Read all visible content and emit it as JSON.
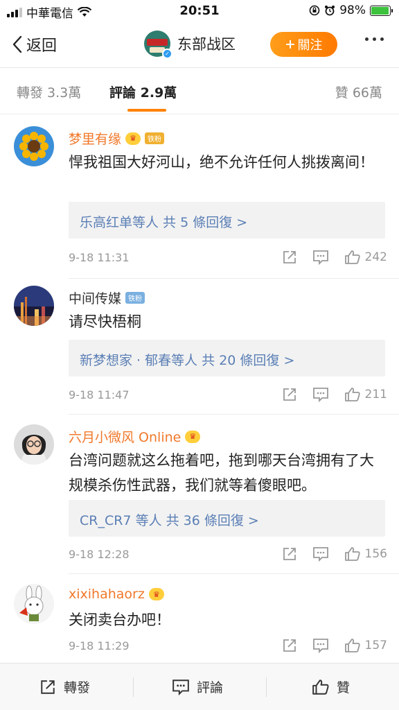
{
  "status_bar": {
    "carrier": "中華電信",
    "time": "20:51",
    "battery_percent": "98%",
    "battery_level": 0.98
  },
  "nav": {
    "back_label": "返回",
    "account_name": "东部战区",
    "follow_label": "關注",
    "avatar_icon": "eastern-theater-emblem"
  },
  "tabs": [
    {
      "label": "轉發 3.3萬",
      "active": false
    },
    {
      "label": "評論 2.9萬",
      "active": true
    },
    {
      "label": "贊 66萬",
      "active": false
    }
  ],
  "colors": {
    "accent": "#ff8200",
    "username_orange": "#f0782a",
    "reply_link": "#5b7fb5"
  },
  "comments": [
    {
      "username": "梦里有缘",
      "badge": "铁粉",
      "text": "悍我祖国大好河山，绝不允许任何人挑拨离间！",
      "replies": "乐高红单等人 共 5 條回復 >",
      "time": "9-18 11:31",
      "likes": "242",
      "avatar": "sunflower"
    },
    {
      "username": "中间传媒",
      "badge": "铁粉",
      "text": "请尽快梧桐",
      "replies": "新梦想家 · 郁春等人 共 20 條回復 >",
      "time": "9-18 11:47",
      "likes": "211",
      "avatar": "city-night"
    },
    {
      "username": "六月小微风 Online",
      "badge": "",
      "text": "台湾问题就这么拖着吧，拖到哪天台湾拥有了大规模杀伤性武器，我们就等着傻眼吧。",
      "replies": "CR_CR7 等人 共 36 條回復 >",
      "time": "9-18 12:28",
      "likes": "156",
      "avatar": "person"
    },
    {
      "username": "xixihahaorz",
      "badge": "",
      "text": "关闭卖台办吧！",
      "replies": "",
      "time": "9-18 11:29",
      "likes": "157",
      "avatar": "rabbit"
    }
  ],
  "bottom_bar": {
    "repost_label": "轉發",
    "comment_label": "評論",
    "like_label": "贊"
  }
}
